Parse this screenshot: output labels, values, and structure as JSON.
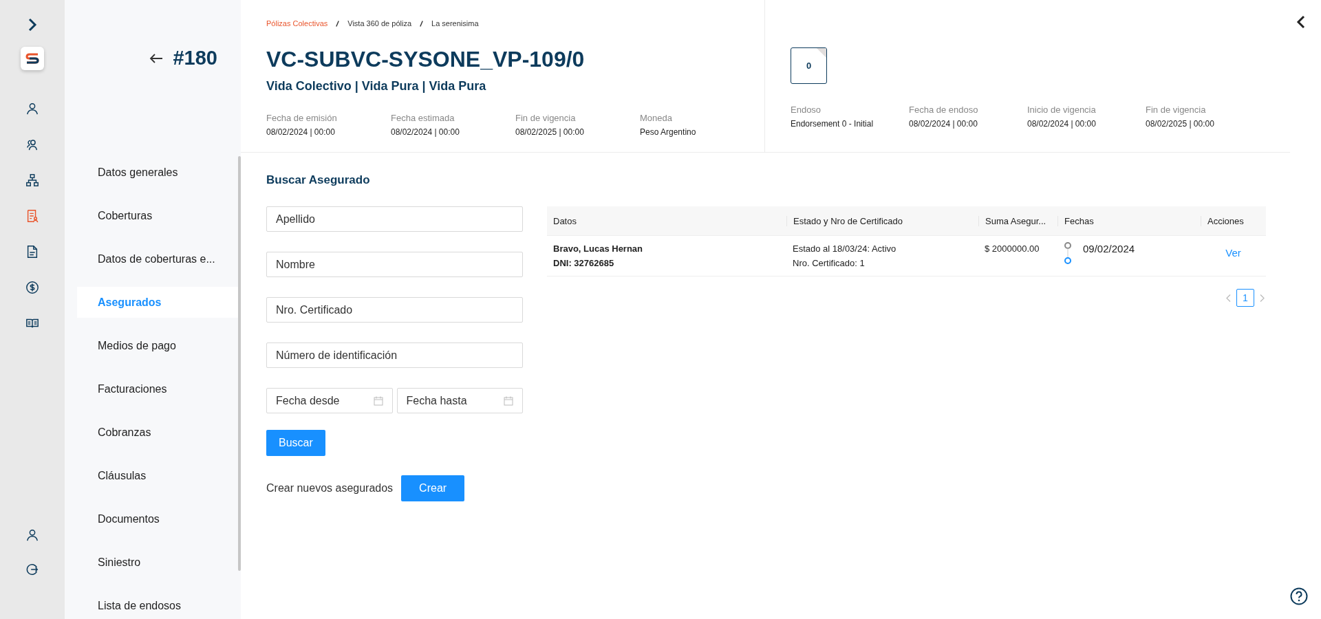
{
  "rail": {
    "items": [
      {
        "kind": "user",
        "selected": false
      },
      {
        "kind": "users",
        "selected": false
      },
      {
        "kind": "tree",
        "selected": false
      },
      {
        "kind": "policy",
        "selected": true
      },
      {
        "kind": "document",
        "selected": false
      },
      {
        "kind": "money",
        "selected": false
      },
      {
        "kind": "book",
        "selected": false
      }
    ],
    "bottom_items": [
      {
        "kind": "user",
        "selected": false
      },
      {
        "kind": "logout",
        "selected": false
      }
    ]
  },
  "sidebar": {
    "back_label": "#180",
    "items": [
      {
        "label": "Datos generales",
        "selected": false
      },
      {
        "label": "Coberturas",
        "selected": false
      },
      {
        "label": "Datos de coberturas e...",
        "selected": false
      },
      {
        "label": "Asegurados",
        "selected": true
      },
      {
        "label": "Medios de pago",
        "selected": false
      },
      {
        "label": "Facturaciones",
        "selected": false
      },
      {
        "label": "Cobranzas",
        "selected": false
      },
      {
        "label": "Cláusulas",
        "selected": false
      },
      {
        "label": "Documentos",
        "selected": false
      },
      {
        "label": "Siniestro",
        "selected": false
      },
      {
        "label": "Lista de endosos",
        "selected": false
      }
    ]
  },
  "breadcrumb": [
    {
      "label": "Pólizas Colectivas",
      "link": true
    },
    {
      "label": "Vista 360 de póliza",
      "link": false
    },
    {
      "label": "La serenisima",
      "link": false
    }
  ],
  "policy": {
    "title": "VC-SUBVC-SYSONE_VP-109/0",
    "subtitle": "Vida Colectivo | Vida Pura | Vida Pura",
    "fields": [
      {
        "label": "Fecha de emisión",
        "value": "08/02/2024 | 00:00"
      },
      {
        "label": "Fecha estimada",
        "value": "08/02/2024 | 00:00"
      },
      {
        "label": "Fin de vigencia",
        "value": "08/02/2025 | 00:00"
      },
      {
        "label": "Moneda",
        "value": "Peso Argentino"
      }
    ]
  },
  "endorsement": {
    "badge": "0",
    "fields": [
      {
        "label": "Endoso",
        "value": "Endorsement 0 - Initial"
      },
      {
        "label": "Fecha de endoso",
        "value": "08/02/2024 | 00:00"
      },
      {
        "label": "Inicio de vigencia",
        "value": "08/02/2024 | 00:00"
      },
      {
        "label": "Fin de vigencia",
        "value": "08/02/2025 | 00:00"
      }
    ]
  },
  "search": {
    "title": "Buscar Asegurado",
    "fields": [
      {
        "placeholder": "Apellido"
      },
      {
        "placeholder": "Nombre"
      },
      {
        "placeholder": "Nro. Certificado"
      },
      {
        "placeholder": "Número de identificación"
      }
    ],
    "date_fields": [
      {
        "placeholder": "Fecha desde"
      },
      {
        "placeholder": "Fecha hasta"
      }
    ],
    "submit": "Buscar",
    "create_label": "Crear nuevos asegurados",
    "create_button": "Crear"
  },
  "table": {
    "columns": [
      "Datos",
      "Estado y Nro de Certificado",
      "Suma Asegur...",
      "Fechas",
      "Acciones"
    ],
    "rows": [
      {
        "name": "Bravo, Lucas Hernan",
        "dni": "DNI: 32762685",
        "status": "Estado al 18/03/24: Activo",
        "certificate": "Nro. Certificado: 1",
        "amount": "$ 2000000.00",
        "date": "09/02/2024",
        "action": "Ver"
      }
    ]
  },
  "pagination": {
    "pages": [
      {
        "label": "1",
        "selected": true
      }
    ]
  }
}
